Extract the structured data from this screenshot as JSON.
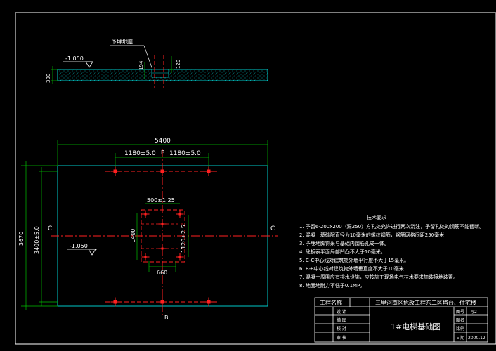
{
  "section_view": {
    "elevation": "-1.050",
    "slab_thickness": "300",
    "pit_depth": "194",
    "pit_width": "120",
    "embedded_label": "予埋地脚"
  },
  "plan": {
    "overall_width": "5400",
    "bolt_spacing_left": "1180±5.0",
    "bolt_spacing_right": "1180±5.0",
    "overall_height": "3670",
    "inner_height": "3400±5.0",
    "elevation": "-1.050",
    "center_width": "500±1.25",
    "center_height_left": "1400",
    "center_height_right": "1120±2.5",
    "center_bottom_width": "660",
    "axis_b": "B",
    "axis_c": "C"
  },
  "notes": {
    "title": "技术要求",
    "items": [
      "1. 予留6-200x200（深250）方孔处允许进行两次浇注，予留孔处的钢筋不能截断。",
      "2. 混凝土基础配直径为10毫米的螺纹钢筋，钢筋网格间距250毫米",
      "3. 予埋地脚钩采与基础内钢筋孔成一体。",
      "4. 砼板表平面局部凹凸不大于10毫米。",
      "5. C-C中心线对建筑物外墙平行度不大于15毫米。",
      "6. B-B中心线对建筑物外墙垂直度不大于10毫米",
      "7. 混凝土周围应有排水设施，应按施工现场电气技术要求加装接地装置。",
      "8. 地面地耐力不低于0.1MP。"
    ]
  },
  "title_block": {
    "project_label": "工程名称",
    "project_name": "三里河南区危改工程东二区塔台、住宅楼",
    "drawing_title": "1#电梯基础图",
    "rows": [
      "设 计",
      "描 图",
      "校 对",
      "审 核"
    ],
    "right_labels": [
      "图号",
      "图名",
      "比例",
      "日期"
    ],
    "drawing_no": "写2",
    "date": "2000.12"
  },
  "colors": {
    "frame": "#ffffff",
    "outline": "#00c8c8",
    "center": "#ff2020",
    "dim": "#00c000",
    "text": "#ffffff"
  }
}
